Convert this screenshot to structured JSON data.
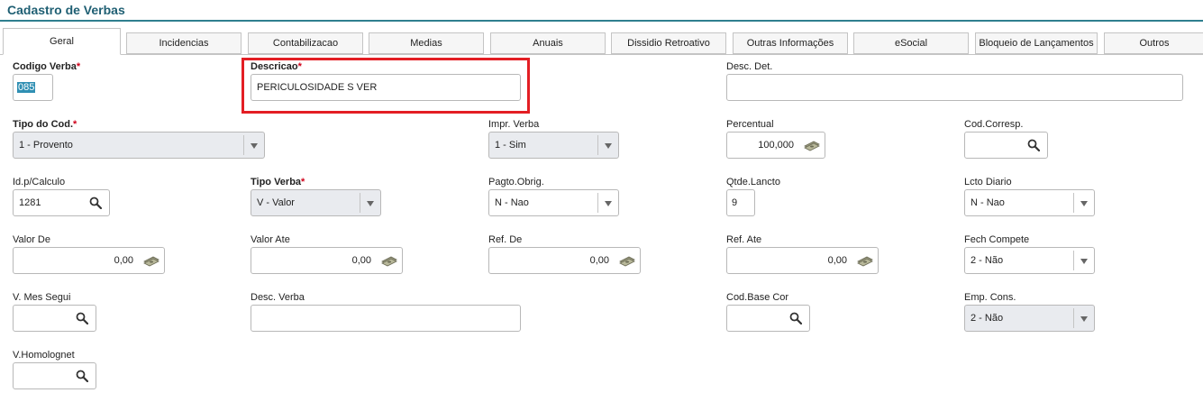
{
  "page": {
    "title": "Cadastro de Verbas"
  },
  "tabs": [
    {
      "label": "Geral",
      "active": true
    },
    {
      "label": "Incidencias"
    },
    {
      "label": "Contabilizacao"
    },
    {
      "label": "Medias"
    },
    {
      "label": "Anuais"
    },
    {
      "label": "Dissidio Retroativo"
    },
    {
      "label": "Outras Informações"
    },
    {
      "label": "eSocial"
    },
    {
      "label": "Bloqueio de Lançamentos"
    },
    {
      "label": "Outros"
    }
  ],
  "fields": {
    "codigo_verba": {
      "label": "Codigo Verba",
      "required_mark": "*",
      "value": "085"
    },
    "descricao": {
      "label": "Descricao",
      "required_mark": "*",
      "value": "PERICULOSIDADE S VER"
    },
    "desc_det": {
      "label": "Desc. Det.",
      "value": ""
    },
    "tipo_do_cod": {
      "label": "Tipo do Cod.",
      "required_mark": "*",
      "value": "1 - Provento"
    },
    "impr_verba": {
      "label": "Impr. Verba",
      "value": "1 - Sim"
    },
    "percentual": {
      "label": "Percentual",
      "value": "100,000"
    },
    "cod_corresp": {
      "label": "Cod.Corresp.",
      "value": ""
    },
    "id_p_calculo": {
      "label": "Id.p/Calculo",
      "value": "1281"
    },
    "tipo_verba": {
      "label": "Tipo Verba",
      "required_mark": "*",
      "value": "V - Valor"
    },
    "pagto_obrig": {
      "label": "Pagto.Obrig.",
      "value": "N - Nao"
    },
    "qtde_lancto": {
      "label": "Qtde.Lancto",
      "value": "9"
    },
    "lcto_diario": {
      "label": "Lcto Diario",
      "value": "N - Nao"
    },
    "valor_de": {
      "label": "Valor De",
      "value": "0,00"
    },
    "valor_ate": {
      "label": "Valor Ate",
      "value": "0,00"
    },
    "ref_de": {
      "label": "Ref. De",
      "value": "0,00"
    },
    "ref_ate": {
      "label": "Ref. Ate",
      "value": "0,00"
    },
    "fech_compete": {
      "label": "Fech Compete",
      "value": "2 - Não"
    },
    "v_mes_segui": {
      "label": "V. Mes Segui",
      "value": ""
    },
    "desc_verba": {
      "label": "Desc. Verba",
      "value": ""
    },
    "cod_base_cor": {
      "label": "Cod.Base Cor",
      "value": ""
    },
    "emp_cons": {
      "label": "Emp. Cons.",
      "value": "2 - Não"
    },
    "v_homolognet": {
      "label": "V.Homolognet",
      "value": ""
    }
  },
  "colors": {
    "title": "#1f5f73",
    "required": "#d0021b",
    "highlight": "#e31e24",
    "readonly_bg": "#e9ebef"
  }
}
